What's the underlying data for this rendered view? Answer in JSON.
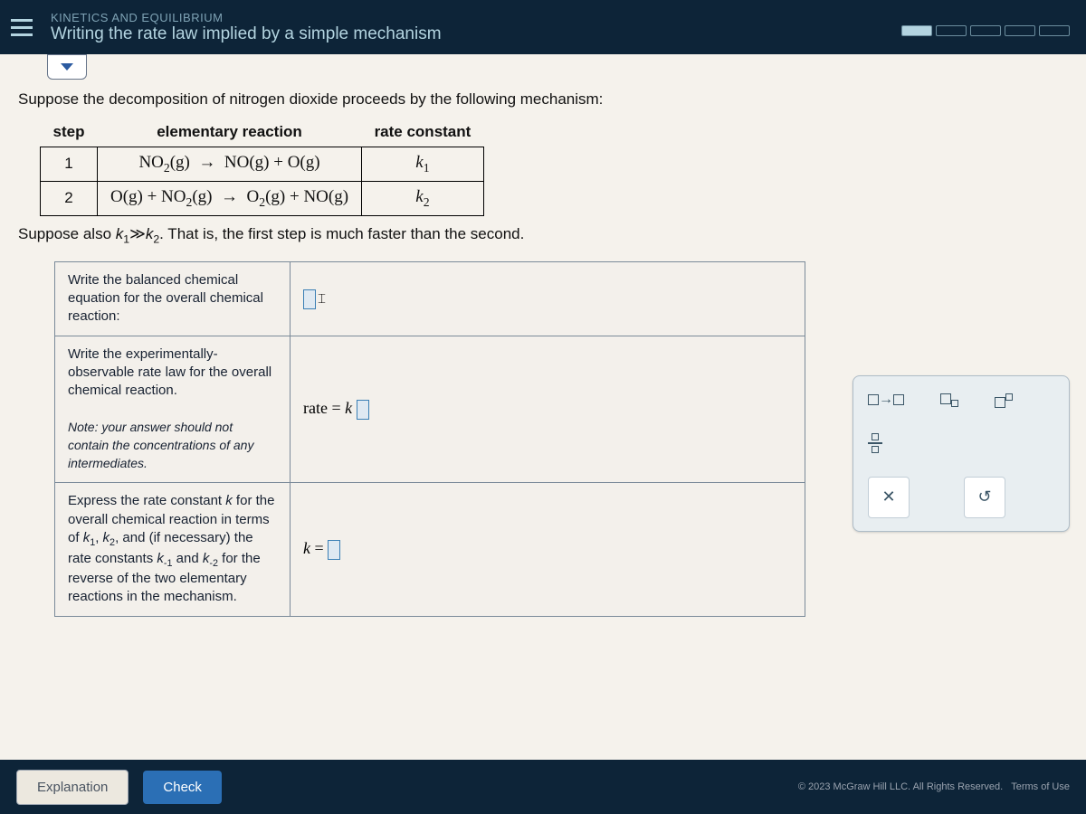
{
  "header": {
    "breadcrumb": "KINETICS AND EQUILIBRIUM",
    "title": "Writing the rate law implied by a simple mechanism",
    "progress_segments": 5,
    "progress_filled": 1
  },
  "question": {
    "intro": "Suppose the decomposition of nitrogen dioxide proceeds by the following mechanism:",
    "table": {
      "headers": [
        "step",
        "elementary reaction",
        "rate constant"
      ],
      "rows": [
        {
          "step": "1",
          "reaction_html": "NO<sub>2</sub>(g)  →  NO(g) + O(g)",
          "k_html": "k<sub>1</sub>"
        },
        {
          "step": "2",
          "reaction_html": "O(g) + NO<sub>2</sub>(g)  →  O<sub>2</sub>(g) + NO(g)",
          "k_html": "k<sub>2</sub>"
        }
      ]
    },
    "hint_html": "Suppose also <i>k</i><sub>1</sub>≫<i>k</i><sub>2</sub>. That is, the first step is much faster than the second."
  },
  "answers": {
    "row1": {
      "prompt": "Write the balanced chemical equation for the overall chemical reaction:",
      "placeholder": "▯"
    },
    "row2": {
      "prompt1": "Write the experimentally-observable rate law for the overall chemical reaction.",
      "note_label": "Note:",
      "note_text": " your answer should not contain the concentrations of any intermediates.",
      "prefix_html": "rate = <i>k</i> "
    },
    "row3": {
      "prompt_html": "Express the rate constant <i>k</i> for the overall chemical reaction in terms of <i>k</i><sub>1</sub>, <i>k</i><sub>2</sub>, and (if necessary) the rate constants <i>k</i><sub>-1</sub> and <i>k</i><sub>-2</sub> for the reverse of the two elementary reactions in the mechanism.",
      "prefix_html": "<i>k</i> = "
    }
  },
  "tool_panel": {
    "tools": [
      {
        "name": "arrow-tool",
        "glyph": "▢→▢"
      },
      {
        "name": "subscript-tool",
        "glyph": "▢▫"
      },
      {
        "name": "superscript-tool",
        "glyph": "▢▫"
      },
      {
        "name": "fraction-tool",
        "glyph": "▢/▢"
      }
    ],
    "clear_label": "✕",
    "reset_label": "↺"
  },
  "footer": {
    "explanation_label": "Explanation",
    "check_label": "Check",
    "copyright": "© 2023 McGraw Hill LLC. All Rights Reserved.",
    "terms_label": "Terms of Use"
  }
}
